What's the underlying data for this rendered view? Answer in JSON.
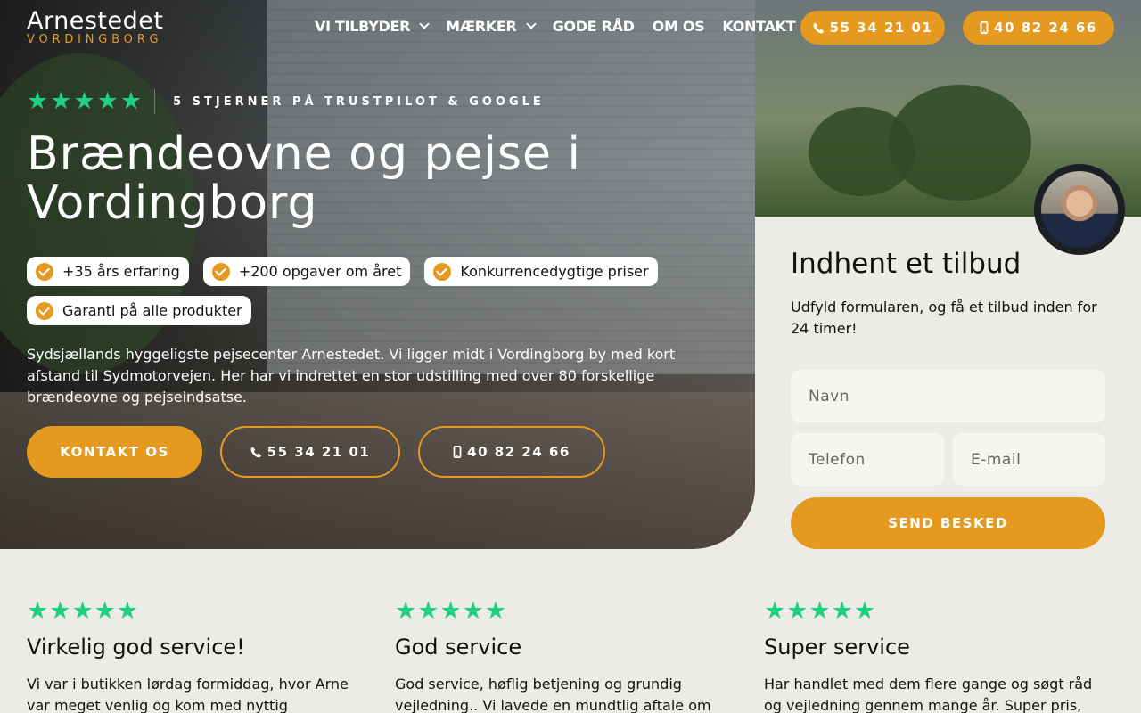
{
  "brand": {
    "name": "Arnestedet",
    "location": "VORDINGBORG",
    "accent": "#e59a1f",
    "star_color": "#1ed07f"
  },
  "nav": {
    "items": [
      {
        "label": "VI TILBYDER",
        "has_dropdown": true
      },
      {
        "label": "MÆRKER",
        "has_dropdown": true
      },
      {
        "label": "GODE RÅD",
        "has_dropdown": false
      },
      {
        "label": "OM OS",
        "has_dropdown": false
      },
      {
        "label": "KONTAKT",
        "has_dropdown": false
      }
    ],
    "phone_landline": "55 34 21 01",
    "phone_mobile": "40 82 24 66"
  },
  "hero": {
    "rating_stars": 5,
    "rating_text": "5 STJERNER PÅ TRUSTPILOT & GOOGLE",
    "title": "Brændeovne og pejse i Vordingborg",
    "badges": [
      "+35 års erfaring",
      "+200 opgaver om året",
      "Konkurrencedygtige priser",
      "Garanti på alle produkter"
    ],
    "intro": "Sydsjællands hyggeligste pejsecenter Arnestedet. Vi ligger midt i Vordingborg by med kort afstand til Sydmotorvejen. Her har vi indrettet en stor udstilling med over 80 forskellige brændeovne og pejseindsatse.",
    "cta_contact": "KONTAKT OS",
    "cta_phone_landline": "55 34 21 01",
    "cta_phone_mobile": "40 82 24 66"
  },
  "form": {
    "title": "Indhent et tilbud",
    "subtitle": "Udfyld formularen, og få et tilbud inden for 24 timer!",
    "name_placeholder": "Navn",
    "phone_placeholder": "Telefon",
    "email_placeholder": "E-mail",
    "submit_label": "SEND BESKED"
  },
  "reviews": [
    {
      "stars": 5,
      "title": "Virkelig god service!",
      "text": "Vi var i butikken lørdag formiddag, hvor Arne var meget venlig og kom med nyttig"
    },
    {
      "stars": 5,
      "title": "God service",
      "text": "God service, høflig betjening og grundig vejledning.. Vi lavede en mundtlig aftale om"
    },
    {
      "stars": 5,
      "title": "Super service",
      "text": "Har handlet med dem flere gange og søgt råd og vejledning gennem mange år. Super pris,"
    }
  ]
}
